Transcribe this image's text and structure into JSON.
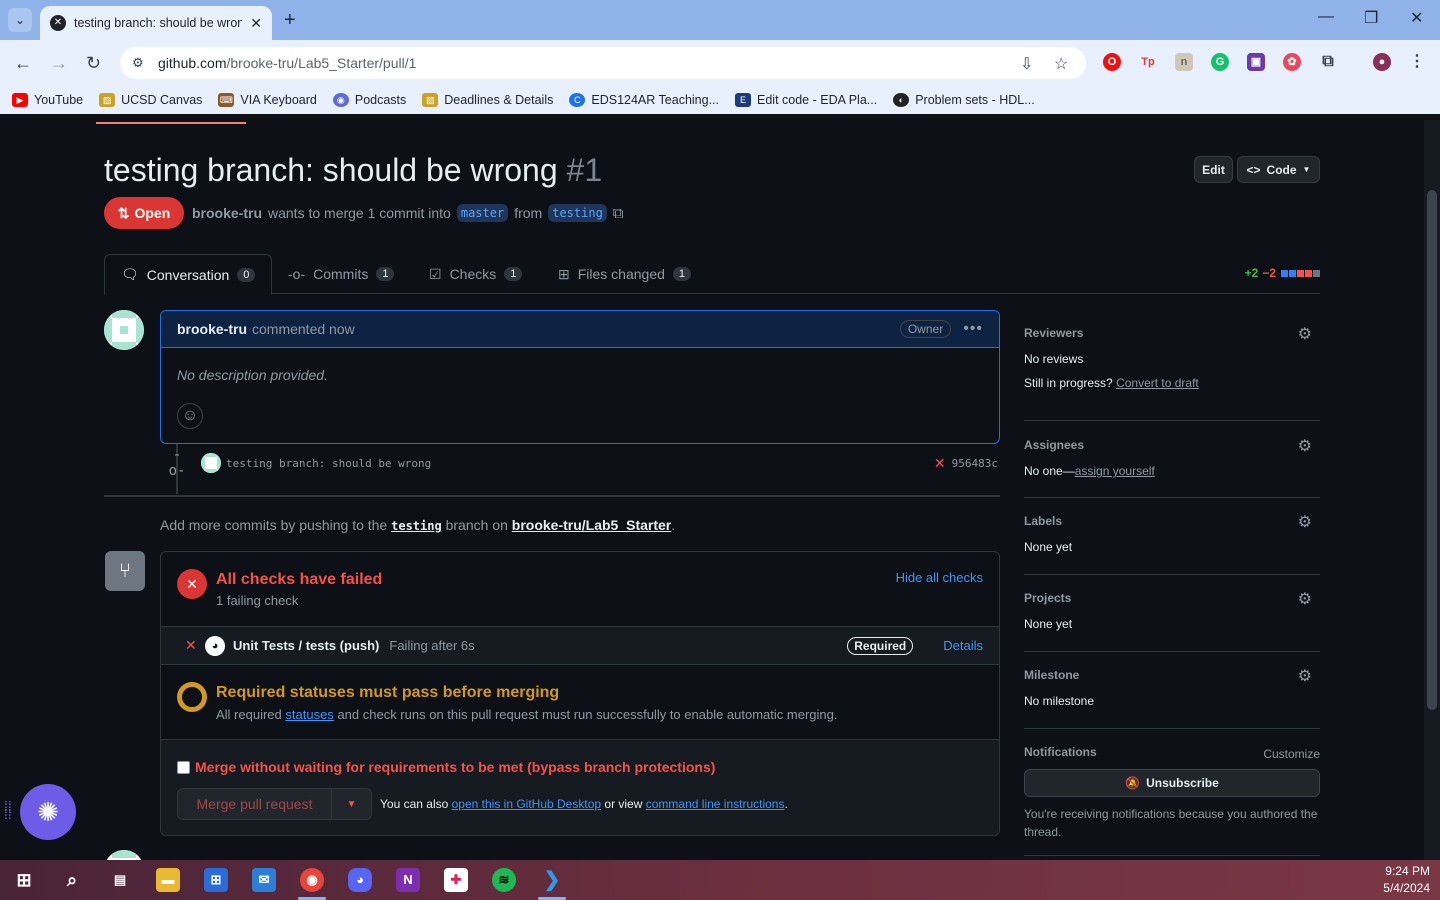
{
  "browser": {
    "tab_title": "testing branch: should be wrong",
    "url_host": "github.com",
    "url_path": "/brooke-tru/Lab5_Starter/pull/1",
    "bookmarks": [
      {
        "label": "YouTube",
        "color": "#ff0000"
      },
      {
        "label": "UCSD Canvas",
        "color": "#c9a227"
      },
      {
        "label": "VIA Keyboard",
        "color": "#8b5a2b"
      },
      {
        "label": "Podcasts",
        "color": "#5f6bd0"
      },
      {
        "label": "Deadlines & Details",
        "color": "#c9a227"
      },
      {
        "label": "EDS124AR Teaching...",
        "color": "#1a73e8"
      },
      {
        "label": "Edit code - EDA Pla...",
        "color": "#1d3a7a"
      },
      {
        "label": "Problem sets - HDL...",
        "color": "#222222"
      }
    ]
  },
  "pr": {
    "title": "testing branch: should be wrong",
    "number": "#1",
    "edit_label": "Edit",
    "code_label": "Code",
    "state": "Open",
    "author": "brooke-tru",
    "merge_text": "wants to merge 1 commit into",
    "base": "master",
    "from_word": "from",
    "head": "testing"
  },
  "tabs": [
    {
      "label": "Conversation",
      "count": "0"
    },
    {
      "label": "Commits",
      "count": "1"
    },
    {
      "label": "Checks",
      "count": "1"
    },
    {
      "label": "Files changed",
      "count": "1"
    }
  ],
  "diffstat": {
    "add": "+2",
    "del": "−2"
  },
  "comment": {
    "author": "brooke-tru",
    "time": "commented now",
    "role": "Owner",
    "body": "No description provided."
  },
  "commit": {
    "message": "testing branch: should be wrong",
    "sha": "956483c"
  },
  "add_more": {
    "prefix": "Add more commits by pushing to the",
    "branch": "testing",
    "middle": "branch on",
    "repo": "brooke-tru/Lab5_Starter",
    "suffix": "."
  },
  "checks": {
    "title": "All checks have failed",
    "subtitle": "1 failing check",
    "hide_label": "Hide all checks",
    "row_name": "Unit Tests / tests (push)",
    "row_status": "Failing after 6s",
    "required_label": "Required",
    "details_label": "Details"
  },
  "requirements": {
    "title": "Required statuses must pass before merging",
    "sub_prefix": "All required",
    "sub_link": "statuses",
    "sub_suffix": "and check runs on this pull request must run successfully to enable automatic merging."
  },
  "merge": {
    "bypass_label": "Merge without waiting for requirements to be met (bypass branch protections)",
    "button_label": "Merge pull request",
    "also_prefix": "You can also",
    "also_link1": "open this in GitHub Desktop",
    "also_middle": "or view",
    "also_link2": "command line instructions",
    "also_suffix": "."
  },
  "sidebar": {
    "reviewers": {
      "heading": "Reviewers",
      "value": "No reviews",
      "progress_q": "Still in progress?",
      "draft_link": "Convert to draft"
    },
    "assignees": {
      "heading": "Assignees",
      "value": "No one—",
      "assign_link": "assign yourself"
    },
    "labels": {
      "heading": "Labels",
      "value": "None yet"
    },
    "projects": {
      "heading": "Projects",
      "value": "None yet"
    },
    "milestone": {
      "heading": "Milestone",
      "value": "No milestone"
    },
    "notifications": {
      "heading": "Notifications",
      "customize": "Customize",
      "unsubscribe": "Unsubscribe",
      "reason": "You're receiving notifications because you authored the thread."
    }
  },
  "taskbar": {
    "time": "9:24 PM",
    "date": "5/4/2024"
  }
}
